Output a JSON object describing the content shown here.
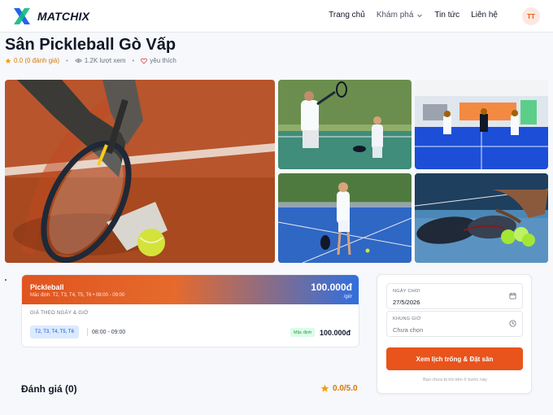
{
  "header": {
    "brand": "MATCHIX",
    "nav": [
      {
        "label": "Trang chủ"
      },
      {
        "label": "Khám phá"
      },
      {
        "label": "Tin tức"
      },
      {
        "label": "Liên hệ"
      }
    ],
    "avatar_initials": "TT"
  },
  "venue": {
    "title": "Sân Pickleball Gò Vấp",
    "rating_text": "0.0 (0 đánh giá)",
    "views_text": "1.2K lượt xem",
    "favorite_text": "yêu thích"
  },
  "pricing": {
    "sport": "Pickleball",
    "default_schedule": "Mặc định: T2, T3, T4, T5, T6 • 08:00 - 09:00",
    "price": "100.000đ",
    "unit": "/giờ",
    "section_label": "GIÁ THEO NGÀY & GIỜ",
    "rows": [
      {
        "days": "T2, T3, T4, T5, T6",
        "time": "08:00 - 09:00",
        "badge": "Mặc định",
        "price": "100.000đ"
      }
    ]
  },
  "reviews": {
    "title": "Đánh giá (0)",
    "score": "0.0/5.0"
  },
  "booking": {
    "date_label": "NGÀY CHƠI",
    "date_value": "27/5/2026",
    "slot_label": "KHUNG GIỜ",
    "slot_value": "Chưa chọn",
    "cta": "Xem lịch trống & Đặt sân",
    "note": "Bạn chưa bị trừ tiền ở bước này"
  },
  "colors": {
    "accent": "#e8541c",
    "rating": "#d97706",
    "badge_blue_bg": "#dbeafe",
    "badge_green_bg": "#dcfce7"
  },
  "icons": [
    "logo-x-icon",
    "chevron-down-icon",
    "star-icon",
    "eye-icon",
    "heart-icon",
    "calendar-icon",
    "clock-icon"
  ]
}
